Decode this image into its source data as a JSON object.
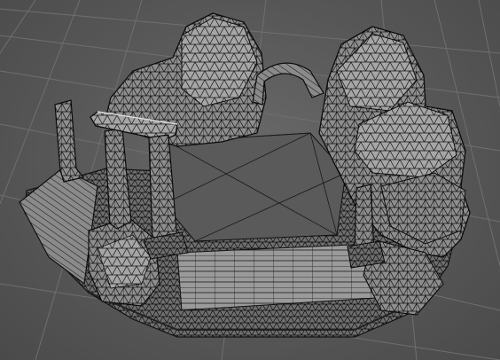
{
  "viewport": {
    "kind": "3d-viewport",
    "render_mode": "wireframe-shaded",
    "model": "rocky-ruin-diorama",
    "colors": {
      "background": "#5a5a5a",
      "grid_line": "#6e6e6e",
      "mesh_fill": "#8c8c8c",
      "mesh_wire": "#0a0a0a",
      "floor_fill": "#5e5e5e",
      "highlight": "#b5b5b5"
    },
    "objects": [
      "base-platform",
      "stone-arch",
      "left-rock-cluster",
      "right-rock-cluster",
      "pillar-left-front",
      "pillar-left-back",
      "pillar-right",
      "post-back-left",
      "stair-ramp",
      "center-floor"
    ]
  }
}
